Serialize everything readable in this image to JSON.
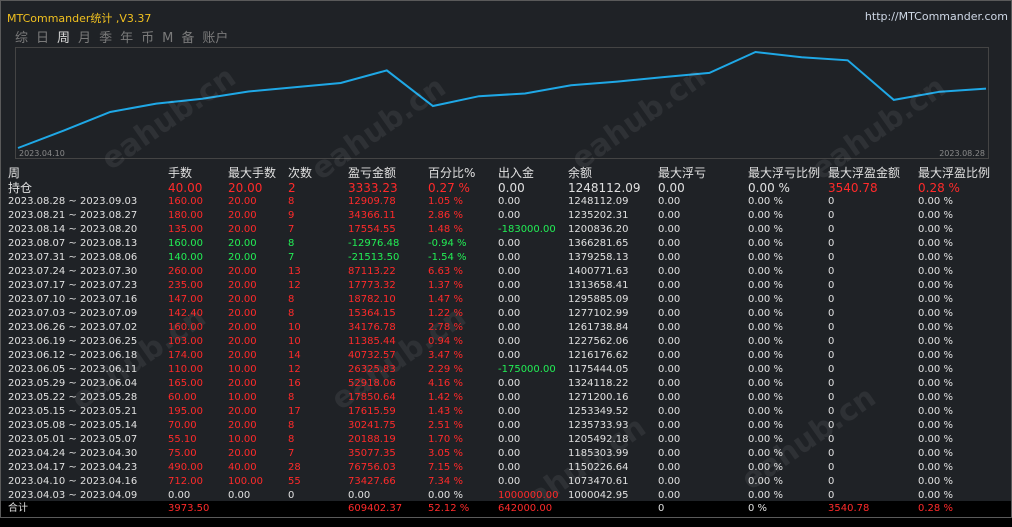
{
  "window": {
    "title": "MTCommander统计 ,V3.37",
    "link": "http://MTCommander.com"
  },
  "tabs": [
    {
      "label": "综",
      "active": false
    },
    {
      "label": "日",
      "active": false
    },
    {
      "label": "周",
      "active": true
    },
    {
      "label": "月",
      "active": false
    },
    {
      "label": "季",
      "active": false
    },
    {
      "label": "年",
      "active": false
    },
    {
      "label": "币",
      "active": false
    },
    {
      "label": "M",
      "active": false
    },
    {
      "label": "备",
      "active": false
    },
    {
      "label": "账户",
      "active": false
    }
  ],
  "watermark": "eahub.cn",
  "chart_data": {
    "type": "line",
    "x_start_label": "2023.04.10",
    "x_end_label": "2023.08.28",
    "line_color": "#1fa8e6",
    "y": [
      1000042.95,
      1073470.61,
      1150226.64,
      1185303.99,
      1205492.18,
      1235733.93,
      1253349.52,
      1271200.16,
      1324118.22,
      1175444.05,
      1216176.62,
      1227562.06,
      1261738.84,
      1277102.99,
      1295885.09,
      1313658.41,
      1400771.63,
      1379258.13,
      1366281.65,
      1200836.2,
      1235202.31,
      1248112.09
    ]
  },
  "headers": [
    "周",
    "手数",
    "最大手数",
    "次数",
    "盈亏金额",
    "百分比%",
    "出入金",
    "余额",
    "最大浮亏",
    "最大浮亏比例",
    "最大浮盈金额",
    "最大浮盈比例"
  ],
  "holding": {
    "cells": [
      "持仓",
      "40.00",
      "20.00",
      "2",
      "3333.23",
      "0.27 %",
      "0.00",
      "1248112.09",
      "0.00",
      "0.00 %",
      "3540.78",
      "0.28 %"
    ],
    "colors": [
      "w",
      "r",
      "r",
      "r",
      "r",
      "r",
      "w",
      "w",
      "w",
      "w",
      "r",
      "r"
    ]
  },
  "rows": [
    {
      "cells": [
        "2023.08.28 ~ 2023.09.03",
        "160.00",
        "20.00",
        "8",
        "12909.78",
        "1.05 %",
        "0.00",
        "1248112.09",
        "0.00",
        "0.00 %",
        "0",
        "0.00 %"
      ],
      "tone": "r"
    },
    {
      "cells": [
        "2023.08.21 ~ 2023.08.27",
        "180.00",
        "20.00",
        "9",
        "34366.11",
        "2.86 %",
        "0.00",
        "1235202.31",
        "0.00",
        "0.00 %",
        "0",
        "0.00 %"
      ],
      "tone": "r"
    },
    {
      "cells": [
        "2023.08.14 ~ 2023.08.20",
        "135.00",
        "20.00",
        "7",
        "17554.55",
        "1.48 %",
        "-183000.00",
        "1200836.20",
        "0.00",
        "0.00 %",
        "0",
        "0.00 %"
      ],
      "tone": "r",
      "flow": "g"
    },
    {
      "cells": [
        "2023.08.07 ~ 2023.08.13",
        "160.00",
        "20.00",
        "8",
        "-12976.48",
        "-0.94 %",
        "0.00",
        "1366281.65",
        "0.00",
        "0.00 %",
        "0",
        "0.00 %"
      ],
      "tone": "g"
    },
    {
      "cells": [
        "2023.07.31 ~ 2023.08.06",
        "140.00",
        "20.00",
        "7",
        "-21513.50",
        "-1.54 %",
        "0.00",
        "1379258.13",
        "0.00",
        "0.00 %",
        "0",
        "0.00 %"
      ],
      "tone": "g"
    },
    {
      "cells": [
        "2023.07.24 ~ 2023.07.30",
        "260.00",
        "20.00",
        "13",
        "87113.22",
        "6.63 %",
        "0.00",
        "1400771.63",
        "0.00",
        "0.00 %",
        "0",
        "0.00 %"
      ],
      "tone": "r"
    },
    {
      "cells": [
        "2023.07.17 ~ 2023.07.23",
        "235.00",
        "20.00",
        "12",
        "17773.32",
        "1.37 %",
        "0.00",
        "1313658.41",
        "0.00",
        "0.00 %",
        "0",
        "0.00 %"
      ],
      "tone": "r"
    },
    {
      "cells": [
        "2023.07.10 ~ 2023.07.16",
        "147.00",
        "20.00",
        "8",
        "18782.10",
        "1.47 %",
        "0.00",
        "1295885.09",
        "0.00",
        "0.00 %",
        "0",
        "0.00 %"
      ],
      "tone": "r"
    },
    {
      "cells": [
        "2023.07.03 ~ 2023.07.09",
        "142.40",
        "20.00",
        "8",
        "15364.15",
        "1.22 %",
        "0.00",
        "1277102.99",
        "0.00",
        "0.00 %",
        "0",
        "0.00 %"
      ],
      "tone": "r"
    },
    {
      "cells": [
        "2023.06.26 ~ 2023.07.02",
        "160.00",
        "20.00",
        "10",
        "34176.78",
        "2.78 %",
        "0.00",
        "1261738.84",
        "0.00",
        "0.00 %",
        "0",
        "0.00 %"
      ],
      "tone": "r"
    },
    {
      "cells": [
        "2023.06.19 ~ 2023.06.25",
        "103.00",
        "20.00",
        "10",
        "11385.44",
        "0.94 %",
        "0.00",
        "1227562.06",
        "0.00",
        "0.00 %",
        "0",
        "0.00 %"
      ],
      "tone": "r"
    },
    {
      "cells": [
        "2023.06.12 ~ 2023.06.18",
        "174.00",
        "20.00",
        "14",
        "40732.57",
        "3.47 %",
        "0.00",
        "1216176.62",
        "0.00",
        "0.00 %",
        "0",
        "0.00 %"
      ],
      "tone": "r"
    },
    {
      "cells": [
        "2023.06.05 ~ 2023.06.11",
        "110.00",
        "10.00",
        "12",
        "26325.83",
        "2.29 %",
        "-175000.00",
        "1175444.05",
        "0.00",
        "0.00 %",
        "0",
        "0.00 %"
      ],
      "tone": "r",
      "flow": "g"
    },
    {
      "cells": [
        "2023.05.29 ~ 2023.06.04",
        "165.00",
        "20.00",
        "16",
        "52918.06",
        "4.16 %",
        "0.00",
        "1324118.22",
        "0.00",
        "0.00 %",
        "0",
        "0.00 %"
      ],
      "tone": "r"
    },
    {
      "cells": [
        "2023.05.22 ~ 2023.05.28",
        "60.00",
        "10.00",
        "8",
        "17850.64",
        "1.42 %",
        "0.00",
        "1271200.16",
        "0.00",
        "0.00 %",
        "0",
        "0.00 %"
      ],
      "tone": "r"
    },
    {
      "cells": [
        "2023.05.15 ~ 2023.05.21",
        "195.00",
        "20.00",
        "17",
        "17615.59",
        "1.43 %",
        "0.00",
        "1253349.52",
        "0.00",
        "0.00 %",
        "0",
        "0.00 %"
      ],
      "tone": "r"
    },
    {
      "cells": [
        "2023.05.08 ~ 2023.05.14",
        "70.00",
        "20.00",
        "8",
        "30241.75",
        "2.51 %",
        "0.00",
        "1235733.93",
        "0.00",
        "0.00 %",
        "0",
        "0.00 %"
      ],
      "tone": "r"
    },
    {
      "cells": [
        "2023.05.01 ~ 2023.05.07",
        "55.10",
        "10.00",
        "8",
        "20188.19",
        "1.70 %",
        "0.00",
        "1205492.18",
        "0.00",
        "0.00 %",
        "0",
        "0.00 %"
      ],
      "tone": "r"
    },
    {
      "cells": [
        "2023.04.24 ~ 2023.04.30",
        "75.00",
        "20.00",
        "7",
        "35077.35",
        "3.05 %",
        "0.00",
        "1185303.99",
        "0.00",
        "0.00 %",
        "0",
        "0.00 %"
      ],
      "tone": "r"
    },
    {
      "cells": [
        "2023.04.17 ~ 2023.04.23",
        "490.00",
        "40.00",
        "28",
        "76756.03",
        "7.15 %",
        "0.00",
        "1150226.64",
        "0.00",
        "0.00 %",
        "0",
        "0.00 %"
      ],
      "tone": "r"
    },
    {
      "cells": [
        "2023.04.10 ~ 2023.04.16",
        "712.00",
        "100.00",
        "55",
        "73427.66",
        "7.34 %",
        "0.00",
        "1073470.61",
        "0.00",
        "0.00 %",
        "0",
        "0.00 %"
      ],
      "tone": "r"
    },
    {
      "cells": [
        "2023.04.03 ~ 2023.04.09",
        "0.00",
        "0.00",
        "0",
        "0.00",
        "0.00 %",
        "1000000.00",
        "1000042.95",
        "0.00",
        "0.00 %",
        "0",
        "0.00 %"
      ],
      "tone": "w",
      "flow": "r"
    }
  ],
  "total": {
    "cells": [
      "合计",
      "3973.50",
      "",
      "",
      "609402.37",
      "52.12 %",
      "642000.00",
      "",
      "0",
      "0 %",
      "3540.78",
      "0.28 %"
    ],
    "colors": [
      "w",
      "r",
      "w",
      "w",
      "r",
      "r",
      "r",
      "w",
      "w",
      "w",
      "r",
      "r"
    ]
  }
}
